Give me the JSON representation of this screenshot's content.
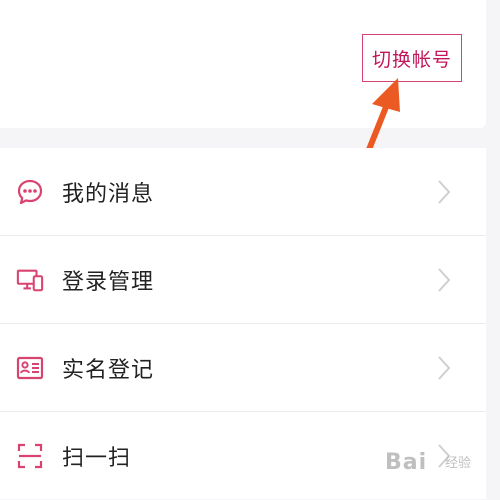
{
  "header": {
    "switch_account_label": "切换帐号"
  },
  "menu": {
    "items": [
      {
        "label": "我的消息",
        "icon": "message-bubble-icon"
      },
      {
        "label": "登录管理",
        "icon": "devices-icon"
      },
      {
        "label": "实名登记",
        "icon": "id-card-icon"
      },
      {
        "label": "扫一扫",
        "icon": "scan-icon"
      }
    ]
  },
  "watermark": {
    "brand": "Bai",
    "sub": "经验"
  },
  "colors": {
    "accent": "#d9436f",
    "arrow": "#ec5a24",
    "chevron": "#cfcfd4"
  }
}
